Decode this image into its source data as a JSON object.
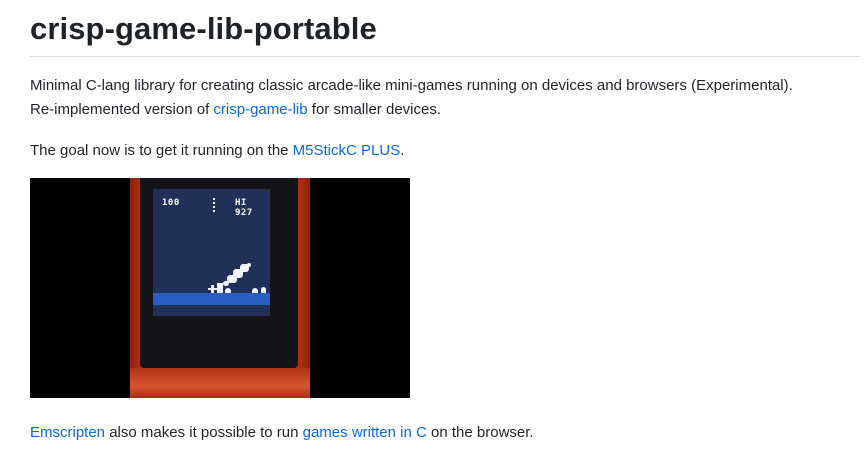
{
  "heading": {
    "title": "crisp-game-lib-portable"
  },
  "intro": {
    "line1": "Minimal C-lang library for creating classic arcade-like mini-games running on devices and browsers (Experimental).",
    "line2_prefix": "Re-implemented version of ",
    "line2_link": "crisp-game-lib",
    "line2_suffix": " for smaller devices."
  },
  "goal": {
    "prefix": "The goal now is to get it running on the ",
    "link": "M5StickC PLUS",
    "suffix": "."
  },
  "media": {
    "score": "100",
    "hi_score": "HI 927"
  },
  "footer_para": {
    "link1": "Emscripten",
    "middle": " also makes it possible to run ",
    "link2": "games written in C",
    "suffix": " on the browser."
  },
  "colors": {
    "link": "#0969da",
    "text": "#1f2328",
    "device_body": "#c43a18",
    "screen": "#203056",
    "ground": "#2a5ec2"
  }
}
